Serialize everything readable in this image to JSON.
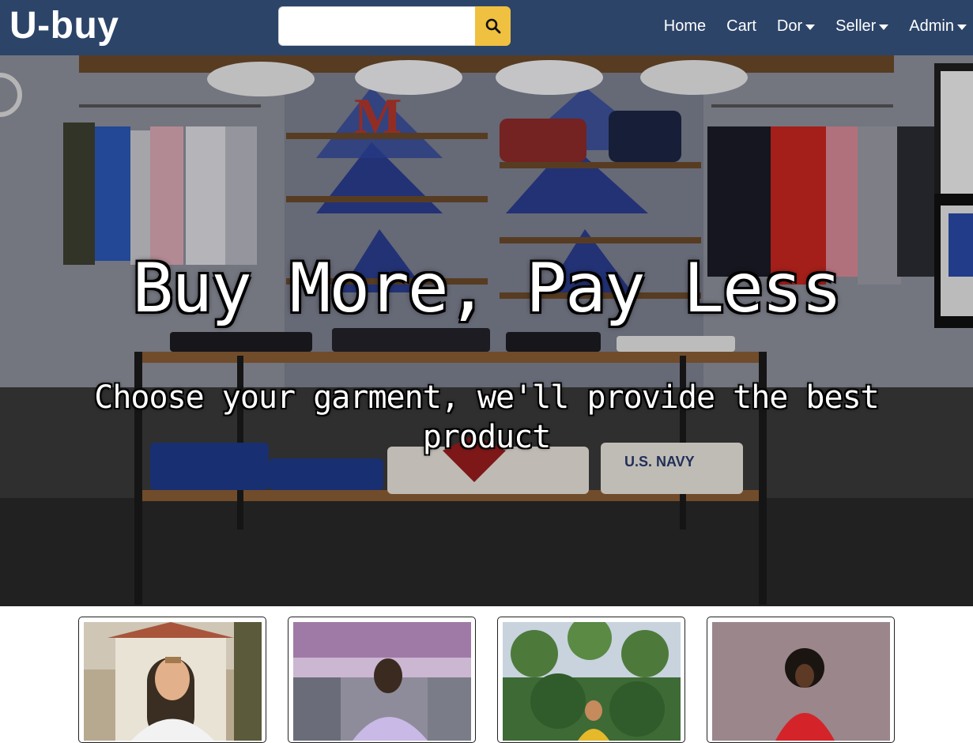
{
  "navbar": {
    "brand": "U-buy",
    "search": {
      "value": "",
      "placeholder": ""
    },
    "links": [
      {
        "label": "Home",
        "dropdown": false
      },
      {
        "label": "Cart",
        "dropdown": false
      },
      {
        "label": "Dor",
        "dropdown": true
      },
      {
        "label": "Seller",
        "dropdown": true
      },
      {
        "label": "Admin",
        "dropdown": true
      }
    ]
  },
  "hero": {
    "title": "Buy More, Pay Less",
    "subtitle": "Choose your garment, we'll provide the best product"
  },
  "products": [
    {
      "image": "man-white-tshirt-photo"
    },
    {
      "image": "man-lavender-shirt-photo"
    },
    {
      "image": "woman-palm-trees-photo"
    },
    {
      "image": "woman-red-jacket-photo"
    }
  ],
  "colors": {
    "navbar_bg": "#2c4468",
    "search_button": "#f0c040"
  }
}
